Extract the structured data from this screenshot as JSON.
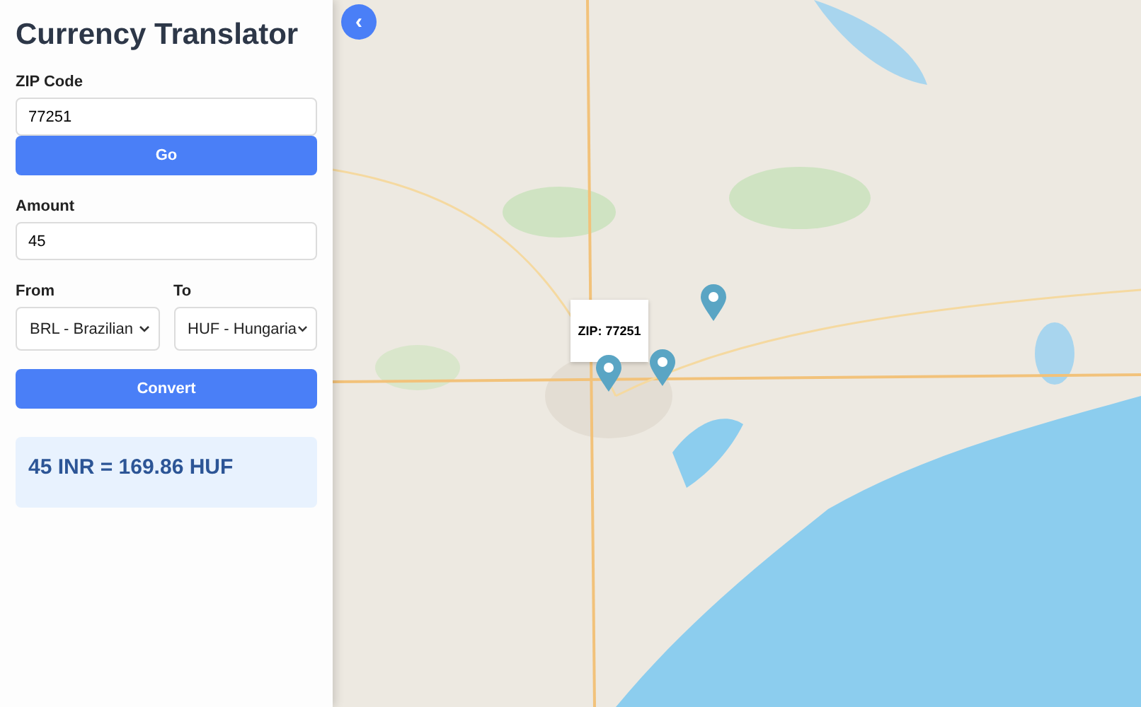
{
  "sidebar": {
    "title": "Currency Translator",
    "zip": {
      "label": "ZIP Code",
      "value": "77251"
    },
    "go_button": "Go",
    "amount": {
      "label": "Amount",
      "value": "45"
    },
    "from": {
      "label": "From",
      "value": "BRL - Brazilian"
    },
    "to": {
      "label": "To",
      "value": "HUF - Hungaria"
    },
    "convert_button": "Convert",
    "result": "45 INR = 169.86 HUF"
  },
  "map": {
    "back_button": "‹",
    "popup": "ZIP: 77251"
  }
}
